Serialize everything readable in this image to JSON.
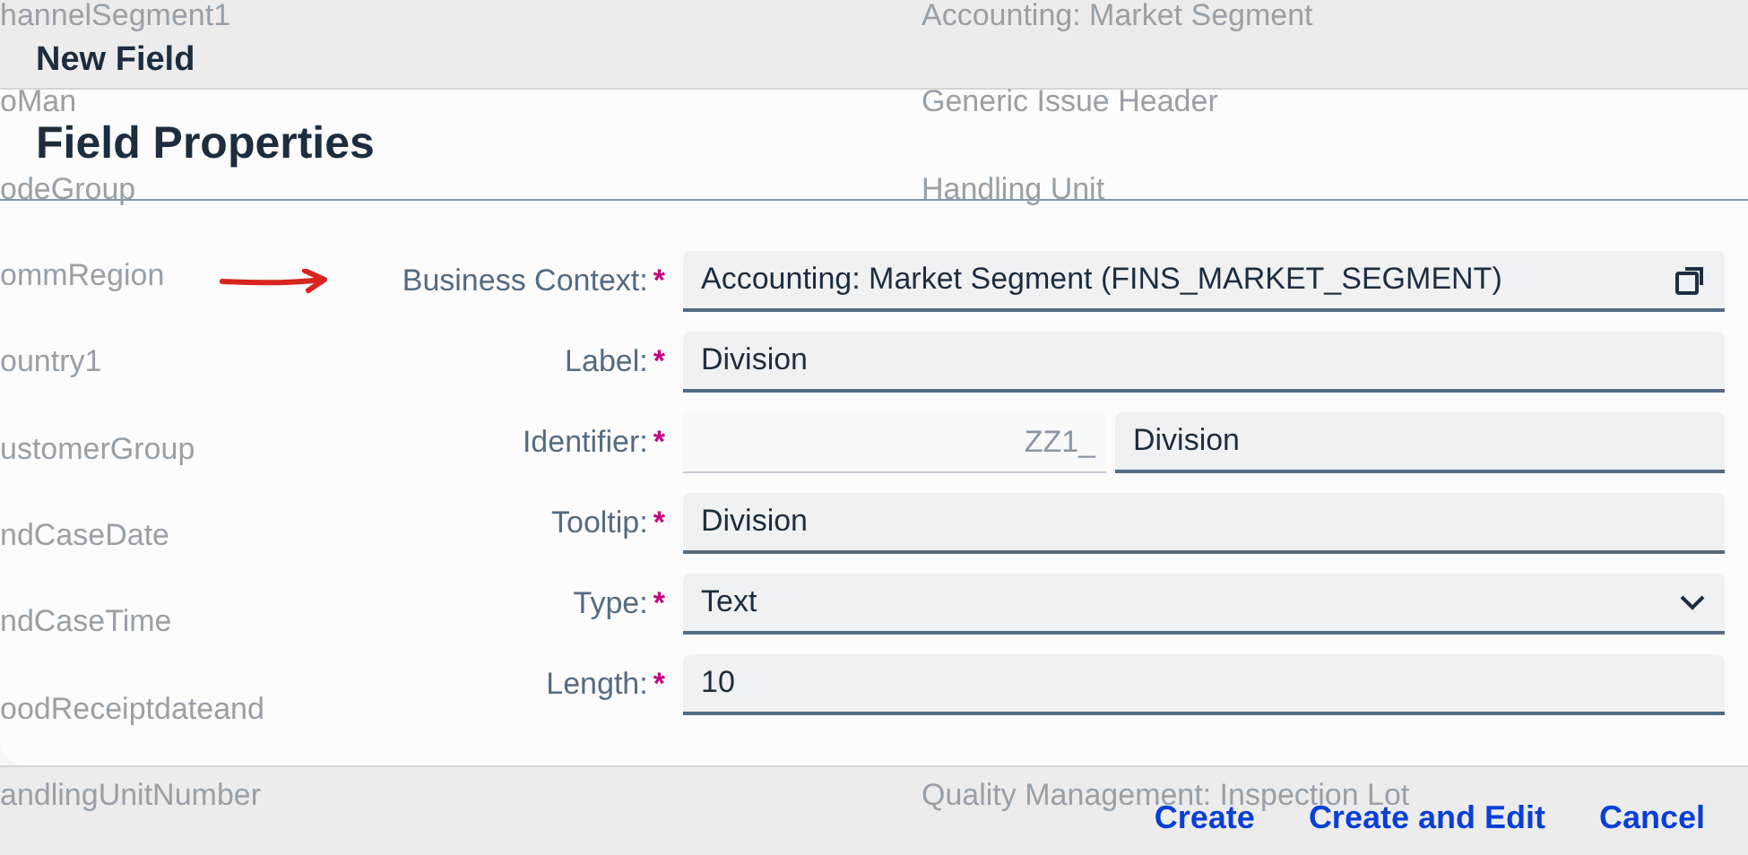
{
  "background_list": {
    "rows": [
      {
        "column_1": "hannelSegment1",
        "column_2": "Accounting: Market Segment"
      },
      {
        "column_1": "oMan",
        "column_2": "Generic Issue Header"
      },
      {
        "column_1": "odeGroup",
        "column_2": "Handling Unit"
      },
      {
        "column_1": "ommRegion"
      },
      {
        "column_1": "ountry1"
      },
      {
        "column_1": "ustomerGroup"
      },
      {
        "column_1": "ndCaseDate"
      },
      {
        "column_1": "ndCaseTime"
      },
      {
        "column_1": "oodReceiptdateand"
      },
      {
        "column_1": "andlingUnitNumber",
        "column_2": "Quality Management: Inspection Lot"
      }
    ]
  },
  "dialog": {
    "title": "New Field",
    "buttons": [
      {
        "label": "Create"
      },
      {
        "label": "Create and Edit"
      },
      {
        "label": "Cancel"
      }
    ]
  },
  "panel": {
    "title": "Field Properties",
    "fields": [
      {
        "kind": "value_help",
        "label": "Business Context:",
        "required_mark": "*",
        "value": "Accounting: Market Segment (FINS_MARKET_SEGMENT)"
      },
      {
        "kind": "text",
        "label": "Label:",
        "required_mark": "*",
        "value": "Division"
      },
      {
        "kind": "prefixed",
        "label": "Identifier:",
        "required_mark": "*",
        "prefix": "ZZ1_",
        "value": "Division"
      },
      {
        "kind": "text",
        "label": "Tooltip:",
        "required_mark": "*",
        "value": "Division"
      },
      {
        "kind": "select",
        "label": "Type:",
        "required_mark": "*",
        "value": "Text"
      },
      {
        "kind": "text",
        "label": "Length:",
        "required_mark": "*",
        "value": "10"
      }
    ]
  }
}
